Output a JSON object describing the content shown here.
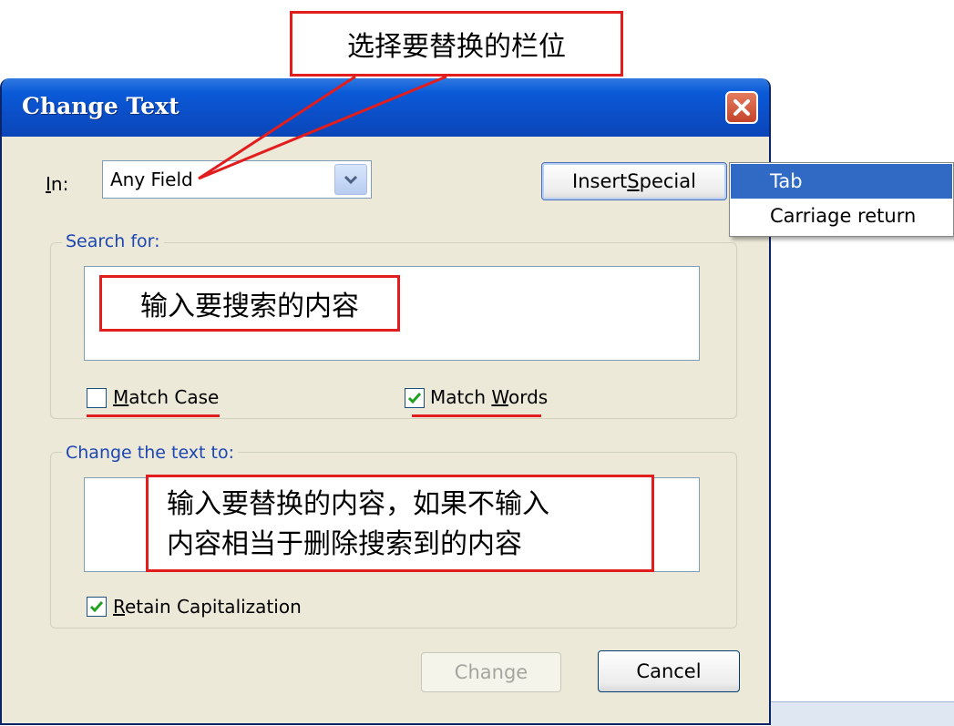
{
  "dialog": {
    "title": "Change Text",
    "in_label_first": "I",
    "in_label_rest": "n:",
    "in_value": "Any Field",
    "insert_special_pre": "Insert ",
    "insert_special_key": "S",
    "insert_special_post": "pecial",
    "search_group_label": "Search for:",
    "search_text": "",
    "match_case_key": "M",
    "match_case_rest": "atch Case",
    "match_case_checked": false,
    "match_words_pre": "Match ",
    "match_words_key": "W",
    "match_words_post": "ords",
    "match_words_checked": true,
    "change_group_label": "Change the text to:",
    "change_text": "",
    "retain_key": "R",
    "retain_rest": "etain Capitalization",
    "retain_checked": true,
    "change_button": "Change",
    "cancel_button": "Cancel"
  },
  "insert_special_menu": {
    "items": [
      "Tab",
      "Carriage return"
    ],
    "highlighted_index": 0,
    "highlight_color": "#316ac5"
  },
  "annotations": {
    "select_field": "选择要替换的栏位",
    "search_content": "输入要搜索的内容",
    "replace_line1": "输入要替换的内容，如果不输入",
    "replace_line2": "内容相当于删除搜索到的内容"
  },
  "colors": {
    "title_bar": "#0b4fc8",
    "dialog_bg": "#ece9d8",
    "annotation_red": "#e11d1d",
    "group_label": "#1c46b4",
    "check_green": "#21a121"
  }
}
